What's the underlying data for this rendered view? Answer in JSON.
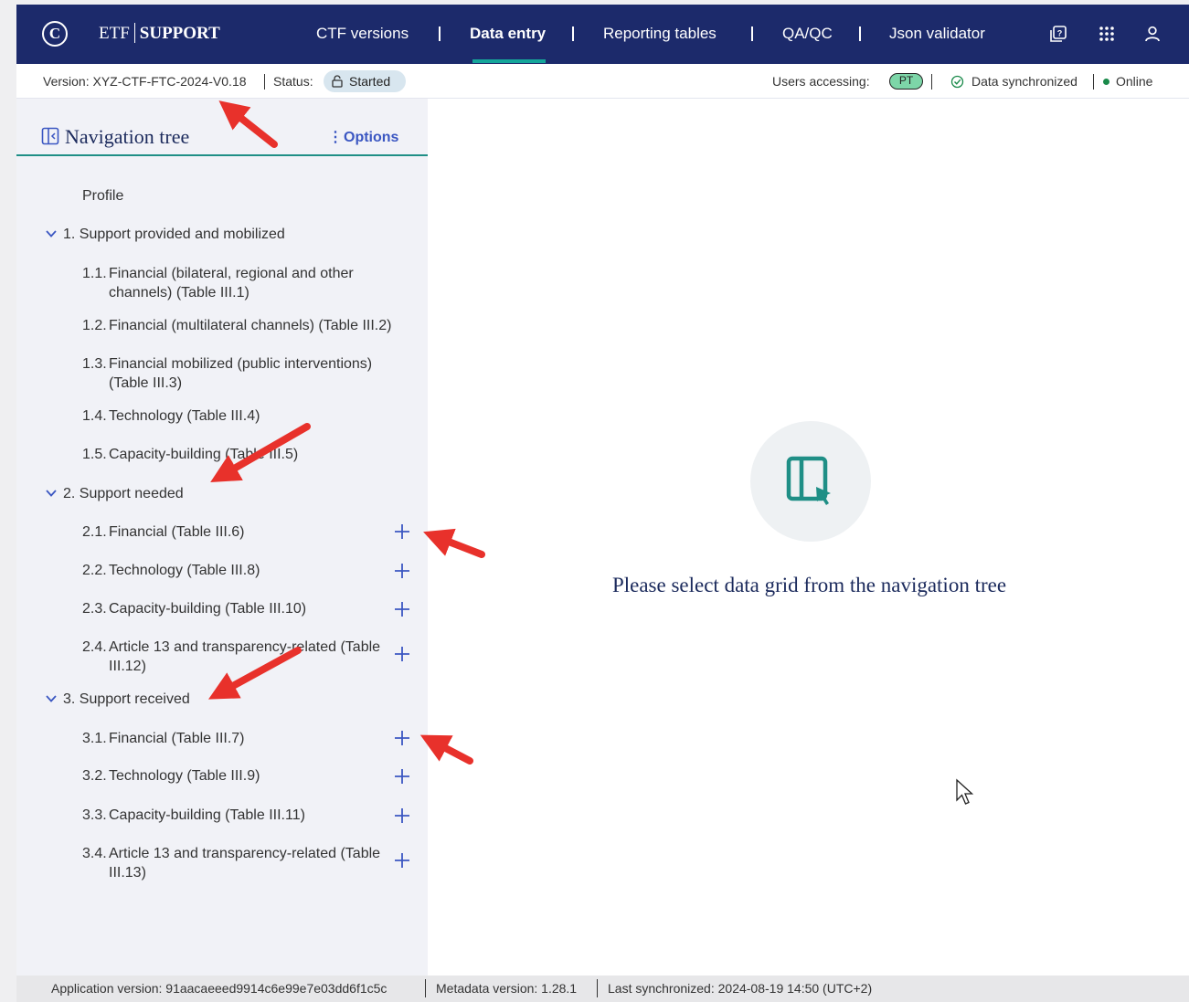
{
  "app": {
    "logo_etf": "ETF",
    "logo_support": "SUPPORT"
  },
  "nav": {
    "items": [
      {
        "label": "CTF versions"
      },
      {
        "label": "Data entry"
      },
      {
        "label": "Reporting tables"
      },
      {
        "label": "QA/QC"
      },
      {
        "label": "Json validator"
      }
    ],
    "active": "Data entry",
    "icons": [
      "help-icon",
      "apps-grid-icon",
      "user-icon"
    ]
  },
  "statusbar": {
    "version": "Version: XYZ-CTF-FTC-2024-V0.18",
    "status_label": "Status:",
    "status_value": "Started",
    "users_label": "Users accessing:",
    "user_initials": "PT",
    "sync_text": "Data synchronized",
    "online_text": "Online"
  },
  "sidebar": {
    "title": "Navigation tree",
    "options_label": "Options",
    "profile": "Profile",
    "sections": [
      {
        "label": "1. Support provided and mobilized",
        "items": [
          {
            "num": "1.1.",
            "label": "Financial (bilateral, regional and other channels) (Table III.1)",
            "addable": false
          },
          {
            "num": "1.2.",
            "label": "Financial (multilateral channels) (Table III.2)",
            "addable": false
          },
          {
            "num": "1.3.",
            "label": "Financial mobilized (public interventions) (Table III.3)",
            "addable": false
          },
          {
            "num": "1.4.",
            "label": "Technology (Table III.4)",
            "addable": false
          },
          {
            "num": "1.5.",
            "label": "Capacity-building (Table III.5)",
            "addable": false
          }
        ]
      },
      {
        "label": "2. Support needed",
        "items": [
          {
            "num": "2.1.",
            "label": "Financial (Table III.6)",
            "addable": true
          },
          {
            "num": "2.2.",
            "label": "Technology (Table III.8)",
            "addable": true
          },
          {
            "num": "2.3.",
            "label": "Capacity-building (Table III.10)",
            "addable": true
          },
          {
            "num": "2.4.",
            "label": "Article 13 and transparency-related (Table III.12)",
            "addable": true
          }
        ]
      },
      {
        "label": "3. Support received",
        "items": [
          {
            "num": "3.1.",
            "label": "Financial (Table III.7)",
            "addable": true
          },
          {
            "num": "3.2.",
            "label": "Technology (Table III.9)",
            "addable": true
          },
          {
            "num": "3.3.",
            "label": "Capacity-building (Table III.11)",
            "addable": true
          },
          {
            "num": "3.4.",
            "label": "Article 13 and transparency-related (Table III.13)",
            "addable": true
          }
        ]
      }
    ]
  },
  "content": {
    "empty_message": "Please select data grid from the navigation tree"
  },
  "footer": {
    "app_version": "Application version: 91aacaeeed9914c6e99e7e03dd6f1c5c",
    "metadata_version": "Metadata version: 1.28.1",
    "last_sync": "Last synchronized: 2024-08-19 14:50 (UTC+2)"
  },
  "colors": {
    "topbar": "#1c2a6b",
    "accent_teal": "#1f8f86",
    "link_blue": "#3b57c2",
    "annotation_red": "#e8312b"
  }
}
